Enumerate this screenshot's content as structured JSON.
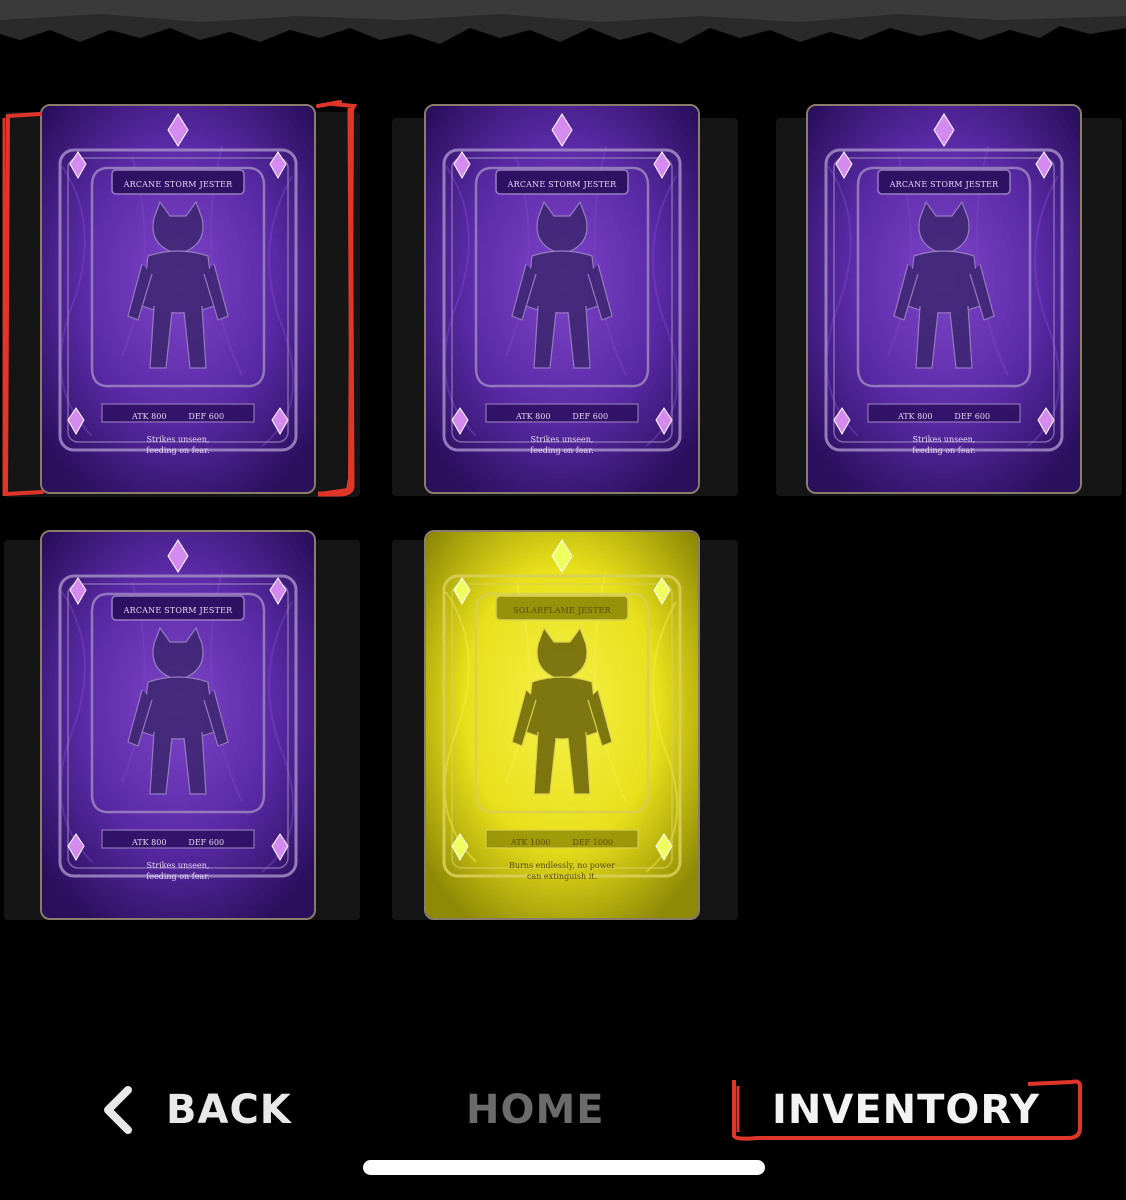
{
  "colors": {
    "background": "#000000",
    "accent_red": "#e0362a",
    "purple_card": "#4a1f8c",
    "gold_card": "#c9c20a"
  },
  "cards": [
    {
      "title": "ARCANE STORM JESTER",
      "atk": "ATK 800",
      "def": "DEF 600",
      "flavor_line1": "Strikes unseen,",
      "flavor_line2": "feeding on fear.",
      "theme": "purple",
      "selected": true
    },
    {
      "title": "ARCANE STORM JESTER",
      "atk": "ATK 800",
      "def": "DEF 600",
      "flavor_line1": "Strikes unseen,",
      "flavor_line2": "feeding on fear.",
      "theme": "purple",
      "selected": false
    },
    {
      "title": "ARCANE STORM JESTER",
      "atk": "ATK 800",
      "def": "DEF 600",
      "flavor_line1": "Strikes unseen,",
      "flavor_line2": "feeding on fear.",
      "theme": "purple",
      "selected": false
    },
    {
      "title": "ARCANE STORM JESTER",
      "atk": "ATK 800",
      "def": "DEF 600",
      "flavor_line1": "Strikes unseen,",
      "flavor_line2": "feeding on fear.",
      "theme": "purple",
      "selected": false
    },
    {
      "title": "SOLARFLAME JESTER",
      "atk": "ATK 1000",
      "def": "DEF 1000",
      "flavor_line1": "Burns endlessly, no power",
      "flavor_line2": "can extinguish it.",
      "theme": "gold",
      "selected": false
    }
  ],
  "nav": {
    "back_icon": "chevron-left-icon",
    "back_label": "BACK",
    "home_label": "HOME",
    "inventory_label": "INVENTORY",
    "active": "inventory"
  }
}
